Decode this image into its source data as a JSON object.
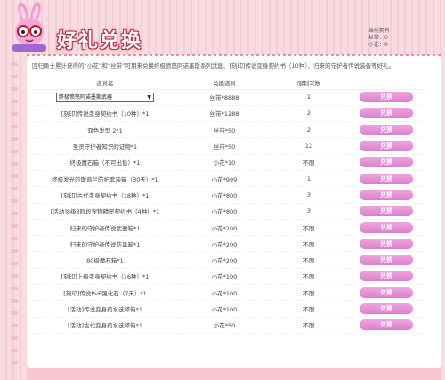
{
  "header": {
    "title": "好礼兑换",
    "holdings_label": "当前拥有",
    "silk_label": "丝带：0",
    "flower_label": "小花：0"
  },
  "intro": "回归勇士累计获得的“小花”和“丝带”可用来兑换终极愤怒阿诺墨斯系列武器、[刻印]传说变身契约书（10种）、归来的守护者传说装备等好礼。",
  "table": {
    "headers": [
      "道具名",
      "兑换道具",
      "限制次数",
      ""
    ],
    "rows": [
      {
        "item": "终极愤怒阿诺墨斯武器",
        "cost": "丝带*8888",
        "limit": "1",
        "btn": "兑换",
        "select": true
      },
      {
        "item": "[刻印]传说变身契约书（10种）*1",
        "cost": "丝带*1288",
        "limit": "2",
        "btn": "兑换"
      },
      {
        "item": "双色发型 2*1",
        "cost": "丝带*50",
        "limit": "2",
        "btn": "兑换"
      },
      {
        "item": "圣灵守护者知识的证物*1",
        "cost": "丝带*50",
        "limit": "12",
        "btn": "兑换"
      },
      {
        "item": "终极魔石箱（不可出售）*1",
        "cost": "小花*10",
        "limit": "不限",
        "btn": "兑换"
      },
      {
        "item": "终极发光的斯普兰防护套装箱（30天）*1",
        "cost": "小花*999",
        "limit": "1",
        "btn": "兑换"
      },
      {
        "item": "[刻印]古代变身契约书（18种）*1",
        "cost": "小花*800",
        "limit": "3",
        "btn": "兑换"
      },
      {
        "item": "[活动]8级3阶段宠物精灵契约书（4种）*1",
        "cost": "小花*800",
        "limit": "3",
        "btn": "兑换"
      },
      {
        "item": "归来的守护者传说武器箱*1",
        "cost": "小花*200",
        "limit": "不限",
        "btn": "兑换"
      },
      {
        "item": "归来的守护者传说防具箱*1",
        "cost": "小花*200",
        "limit": "不限",
        "btn": "兑换"
      },
      {
        "item": "80级魔石箱*1",
        "cost": "小花*200",
        "limit": "不限",
        "btn": "兑换"
      },
      {
        "item": "[刻印]上级变身契约书（16种）*1",
        "cost": "小花*100",
        "limit": "不限",
        "btn": "兑换"
      },
      {
        "item": "[刻印]传说PvE强化石（7天）*1",
        "cost": "小花*100",
        "limit": "不限",
        "btn": "兑换"
      },
      {
        "item": "[活动]传说变身药水选择箱*1",
        "cost": "小花*100",
        "limit": "不限",
        "btn": "兑换"
      },
      {
        "item": "[活动]古代变身药水选择箱*1",
        "cost": "小花*50",
        "limit": "不限",
        "btn": "兑换"
      }
    ]
  }
}
